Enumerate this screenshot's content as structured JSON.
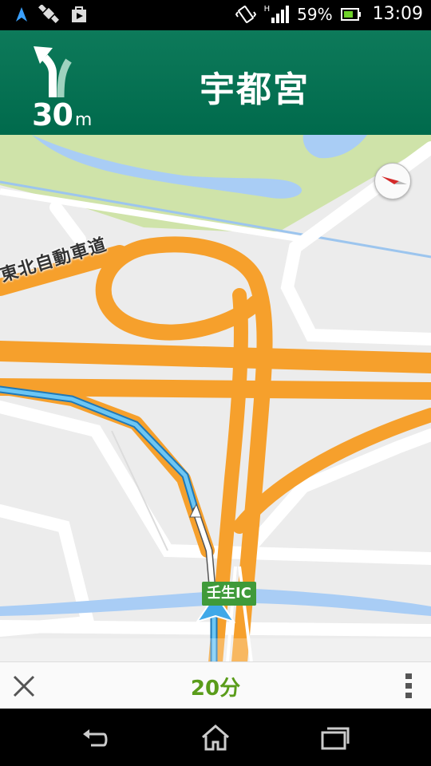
{
  "status_bar": {
    "battery_percent": "59%",
    "time": "13:09",
    "network_label": "H",
    "icons": [
      "navigation-arrow-icon",
      "satellite-icon",
      "play-store-icon",
      "vibrate-icon",
      "signal-icon",
      "battery-icon"
    ]
  },
  "nav_header": {
    "distance_value": "30",
    "distance_unit": "m",
    "destination": "宇都宮",
    "turn_direction": "slight-left"
  },
  "map": {
    "road_label": "東北自動車道",
    "interchange_label": "壬生IC",
    "colors": {
      "highway": "#f6a02c",
      "route": "#3fa8e8",
      "water": "#a9cdf5",
      "park": "#cfe3a9",
      "base": "#ececec"
    }
  },
  "bottom_bar": {
    "eta": "20分"
  },
  "system_nav": {
    "buttons": [
      "back",
      "home",
      "recent-apps"
    ]
  }
}
